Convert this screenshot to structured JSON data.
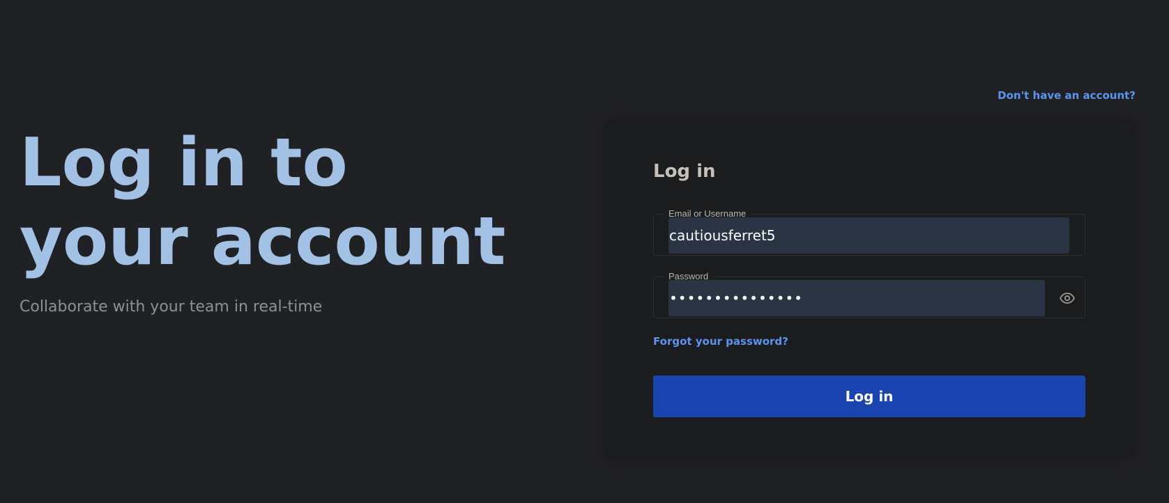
{
  "hero": {
    "title_line1": "Log in to",
    "title_line2": "your account",
    "subtitle": "Collaborate with your team in real-time"
  },
  "signup": {
    "label": "Don't have an account?"
  },
  "form": {
    "title": "Log in",
    "email": {
      "label": "Email or Username",
      "value": "cautiousferret5"
    },
    "password": {
      "label": "Password",
      "value": "•••••••••••••••",
      "toggle_icon": "eye-icon"
    },
    "forgot_label": "Forgot your password?",
    "submit_label": "Log in"
  },
  "colors": {
    "background": "#202124",
    "card": "#1b1c1e",
    "hero_title": "#a3c1e4",
    "link": "#5b95ee",
    "primary_button": "#1a45b0",
    "input_fill": "#2b3445"
  }
}
